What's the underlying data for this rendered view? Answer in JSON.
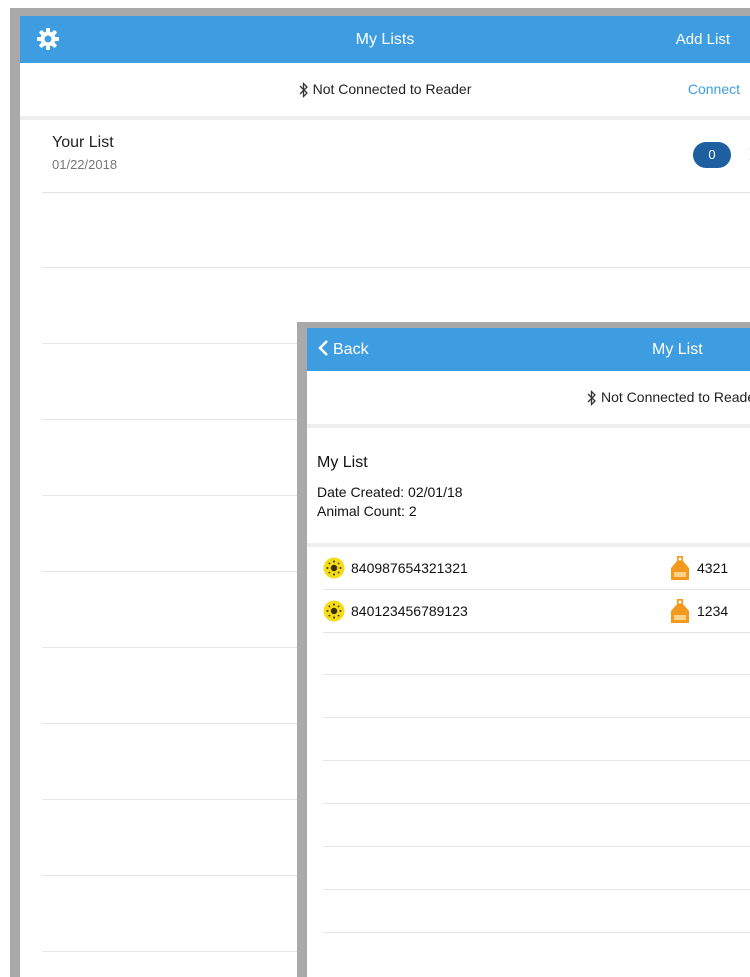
{
  "main_screen": {
    "header": {
      "settings_icon": "gear-icon",
      "title": "My Lists",
      "add_list_label": "Add List"
    },
    "reader_status": {
      "bluetooth_icon": "bluetooth-icon",
      "text": "Not Connected to Reader",
      "connect_label": "Connect"
    },
    "lists": [
      {
        "name": "Your List",
        "date": "01/22/2018",
        "count": "0"
      }
    ]
  },
  "detail_screen": {
    "header": {
      "back_label": "Back",
      "title": "My List"
    },
    "reader_status": {
      "bluetooth_icon": "bluetooth-icon",
      "text": "Not Connected to Reader"
    },
    "list_info": {
      "name": "My List",
      "date_created": "Date Created: 02/01/18",
      "animal_count": "Animal Count: 2"
    },
    "animals": [
      {
        "eid": "840987654321321",
        "tag": "4321"
      },
      {
        "eid": "840123456789123",
        "tag": "1234"
      }
    ]
  },
  "colors": {
    "accent": "#3d9de0",
    "badge": "#1e5fa0",
    "eid_icon": "#f5dc1a",
    "tag_icon": "#f39a1e",
    "frame": "#a9a9a9"
  }
}
